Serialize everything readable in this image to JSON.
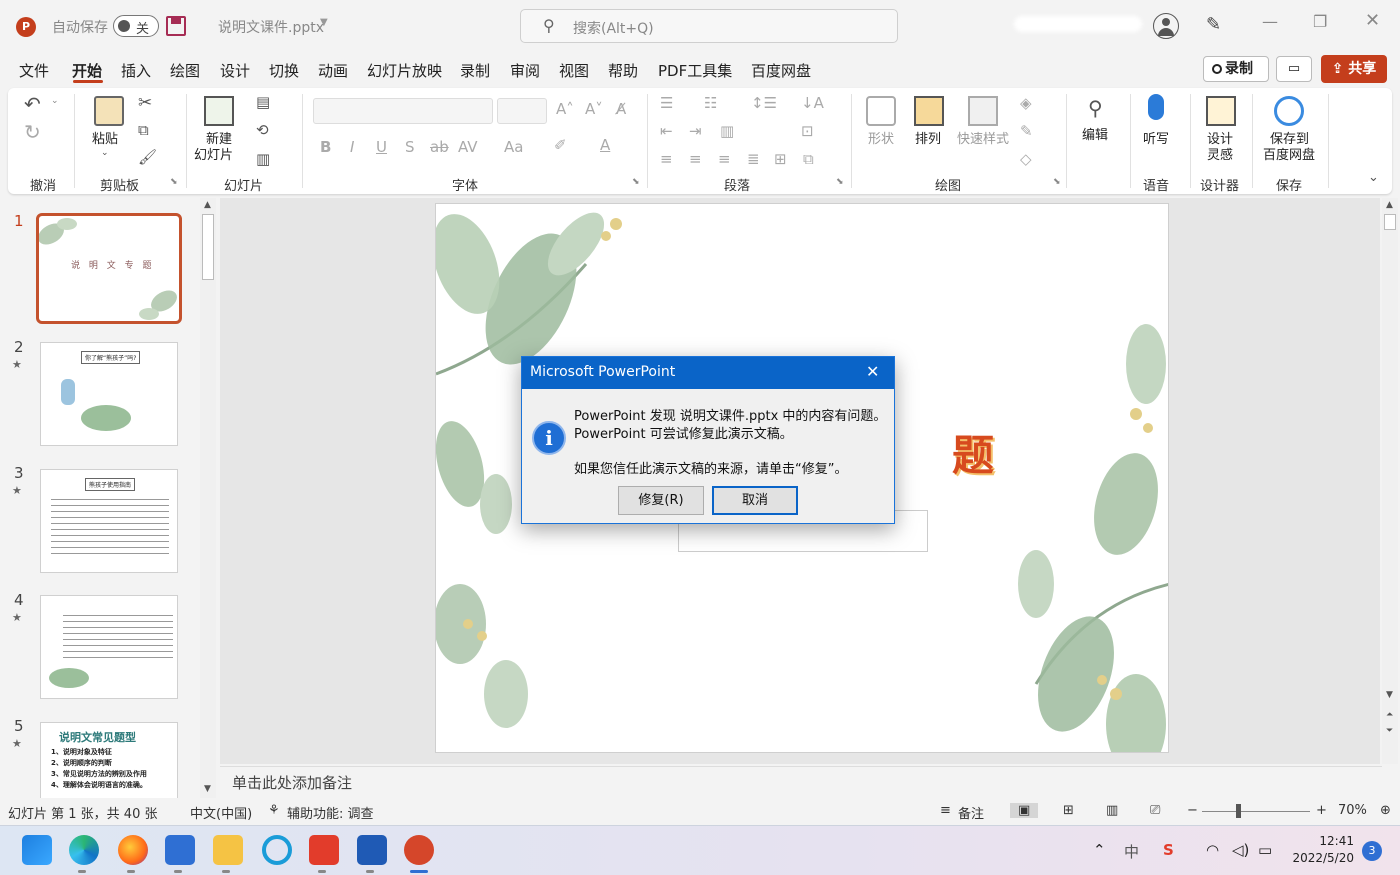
{
  "titlebar": {
    "app_logo": "P",
    "autosave_label": "自动保存",
    "autosave_state": "关",
    "doc_name": "说明文课件.pptx",
    "search_placeholder": "搜索(Alt+Q)"
  },
  "menu": {
    "tabs": [
      "文件",
      "开始",
      "插入",
      "绘图",
      "设计",
      "切换",
      "动画",
      "幻灯片放映",
      "录制",
      "审阅",
      "视图",
      "帮助",
      "PDF工具集",
      "百度网盘"
    ],
    "active_tab": "开始",
    "record_label": "录制",
    "share_label": "共享"
  },
  "ribbon": {
    "groups": {
      "undo": "撤消",
      "clipboard": "剪贴板",
      "slides": "幻灯片",
      "font": "字体",
      "paragraph": "段落",
      "drawing": "绘图",
      "voice": "语音",
      "designer": "设计器",
      "save": "保存"
    },
    "paste_label": "粘贴",
    "new_slide_label1": "新建",
    "new_slide_label2": "幻灯片",
    "shape_label": "形状",
    "arrange_label": "排列",
    "quick_style_label": "快速样式",
    "edit_label": "编辑",
    "dictate_label": "听写",
    "designer_label1": "设计",
    "designer_label2": "灵感",
    "save_baidu_label1": "保存到",
    "save_baidu_label2": "百度网盘"
  },
  "slides_panel": {
    "thumbs": [
      {
        "num": "1",
        "caption": "说 明 文 专 题"
      },
      {
        "num": "2",
        "caption": "你了解“熊孩子”吗?"
      },
      {
        "num": "3",
        "caption": "熊孩子使用指南"
      },
      {
        "num": "4",
        "caption": ""
      },
      {
        "num": "5",
        "caption": "说明文常见题型"
      }
    ],
    "thumb5_lines": [
      "1、说明对象及特征",
      "2、说明顺序的判断",
      "3、常见说明方法的辨别及作用",
      "4、理解体会说明语言的准确。"
    ]
  },
  "main_slide": {
    "visible_title": "题"
  },
  "notes_placeholder": "单击此处添加备注",
  "status": {
    "slide_info": "幻灯片 第 1 张，共 40 张",
    "language": "中文(中国)",
    "accessibility": "辅助功能: 调查",
    "notes_btn": "备注",
    "zoom": "70%"
  },
  "dialog": {
    "title": "Microsoft PowerPoint",
    "line1": "PowerPoint 发现 说明文课件.pptx 中的内容有问题。",
    "line2": "PowerPoint 可尝试修复此演示文稿。",
    "line3": "如果您信任此演示文稿的来源，请单击“修复”。",
    "repair_btn": "修复(R)",
    "cancel_btn": "取消"
  },
  "taskbar": {
    "time": "12:41",
    "date": "2022/5/20",
    "notifications": "3",
    "ime": "中"
  },
  "colors": {
    "accent": "#c43e1c",
    "dialog_title": "#0a64c8",
    "selected_thumb": "#c4522d"
  }
}
